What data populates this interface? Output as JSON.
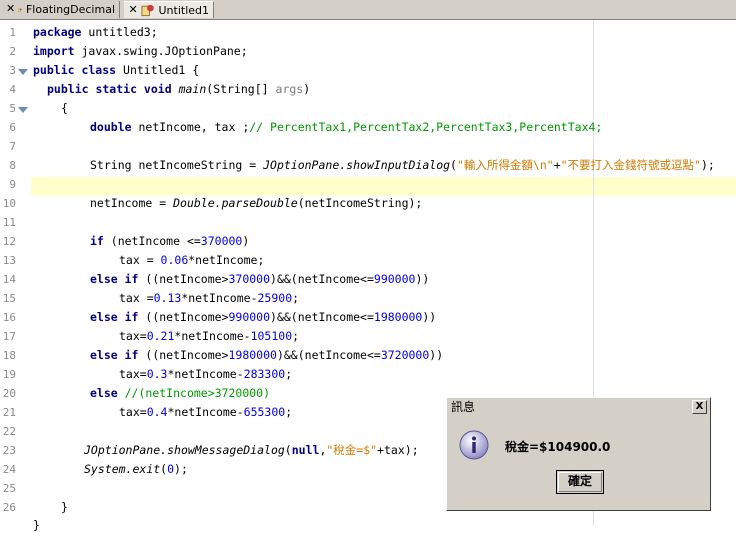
{
  "tabs": [
    {
      "label": "FloatingDecimal",
      "close": "✕",
      "icon": "java-class-icon"
    },
    {
      "label": "Untitled1",
      "close": "✕",
      "icon": "java-class-icon",
      "active": true
    }
  ],
  "line_numbers": [
    "1",
    "2",
    "3",
    "4",
    "5",
    "6",
    "7",
    "8",
    "9",
    "10",
    "11",
    "12",
    "13",
    "14",
    "15",
    "16",
    "17",
    "18",
    "19",
    "20",
    "21",
    "22",
    "23",
    "24",
    "25",
    "26"
  ],
  "code": {
    "l1_kw": "package",
    "l1_rest": " untitled3;",
    "l2_kw": "import",
    "l2_rest": " javax.swing.JOptionPane;",
    "l3_kw": "public class",
    "l3_rest": " Untitled1 {",
    "l4_kw": "public static void",
    "l4_m": "main",
    "l4_a": "(String[] ",
    "l4_arg": "args",
    "l4_b": ")",
    "l5": "{",
    "l6_kw": "double",
    "l6_rest": " netIncome, tax ;",
    "l6_cm": "// PercentTax1,PercentTax2,PercentTax3,PercentTax4;",
    "l8_a": "String netIncomeString = ",
    "l8_cls": "JOptionPane",
    "l8_m": ".showInputDialog",
    "l8_b": "(",
    "l8_s1": "\"輸入所得金額\\n\"",
    "l8_plus": "+",
    "l8_s2": "\"不要打入金錢符號或逗點\"",
    "l8_c": ");",
    "l10_a": "netIncome = ",
    "l10_cls": "Double",
    "l10_m": ".parseDouble",
    "l10_b": "(netIncomeString);",
    "l12_kw": "if",
    "l12_a": " (netIncome <=",
    "l12_n": "370000",
    "l12_b": ")",
    "l13_a": "tax = ",
    "l13_n": "0.06",
    "l13_b": "*netIncome;",
    "l14_kw": "else if",
    "l14_a": " ((netIncome>",
    "l14_n1": "370000",
    "l14_b": ")&&(netIncome<=",
    "l14_n2": "990000",
    "l14_c": "))",
    "l15_a": "tax =",
    "l15_n1": "0.13",
    "l15_b": "*netIncome-",
    "l15_n2": "25900",
    "l15_c": ";",
    "l16_kw": "else if",
    "l16_a": " ((netIncome>",
    "l16_n1": "990000",
    "l16_b": ")&&(netIncome<=",
    "l16_n2": "1980000",
    "l16_c": "))",
    "l17_a": "tax=",
    "l17_n1": "0.21",
    "l17_b": "*netIncome-",
    "l17_n2": "105100",
    "l17_c": ";",
    "l18_kw": "else if",
    "l18_a": " ((netIncome>",
    "l18_n1": "1980000",
    "l18_b": ")&&(netIncome<=",
    "l18_n2": "3720000",
    "l18_c": "))",
    "l19_a": "tax=",
    "l19_n1": "0.3",
    "l19_b": "*netIncome-",
    "l19_n2": "283300",
    "l19_c": ";",
    "l20_kw": "else",
    "l20_cm": " //(netIncome>3720000)",
    "l21_a": "tax=",
    "l21_n1": "0.4",
    "l21_b": "*netIncome-",
    "l21_n2": "655300",
    "l21_c": ";",
    "l23_cls": "JOptionPane",
    "l23_m": ".showMessageDialog",
    "l23_a": "(",
    "l23_kw": "null",
    "l23_b": ",",
    "l23_s": "\"稅金=$\"",
    "l23_c": "+tax);",
    "l24_cls": "System",
    "l24_m": ".exit",
    "l24_a": "(",
    "l24_n": "0",
    "l24_b": ");",
    "l26": "}",
    "l27": "}"
  },
  "dialog": {
    "title": "訊息",
    "close": "X",
    "message": "稅金=$104900.0",
    "ok_label": "確定",
    "icon": "information-icon"
  }
}
